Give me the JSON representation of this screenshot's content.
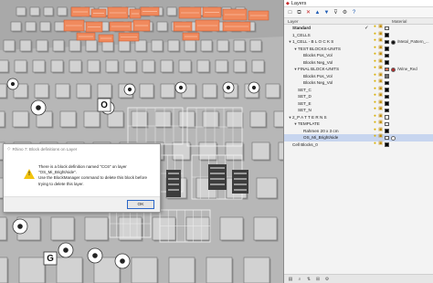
{
  "panel": {
    "title": "Layers",
    "toolbar_icons": [
      "new-layer-icon",
      "new-sublayer-icon",
      "delete-icon",
      "move-up-icon",
      "move-down-icon",
      "filter-icon",
      "tools-icon",
      "help-icon"
    ],
    "columns": {
      "layer": "Layer",
      "material": "Material"
    },
    "layers": [
      {
        "name": "Standard",
        "indent": 0,
        "bold": true,
        "expander": "",
        "current": true,
        "color": "#ffffff",
        "material": "",
        "selected": false
      },
      {
        "name": "1_CELLS",
        "indent": 0,
        "bold": false,
        "expander": "",
        "current": false,
        "color": "#000000",
        "material": "",
        "selected": false
      },
      {
        "name": "1_CELL - B L O C K S",
        "indent": 0,
        "bold": false,
        "expander": "▼",
        "current": false,
        "color": "#000000",
        "material": "/Metal_Pattern_...",
        "material_color": "#111111",
        "selected": false
      },
      {
        "name": "TEST BLOCKS-UNITS",
        "indent": 1,
        "bold": false,
        "expander": "▼",
        "current": false,
        "color": "#000000",
        "material": "",
        "selected": false
      },
      {
        "name": "Blocks Pos_Vol",
        "indent": 2,
        "bold": false,
        "expander": "",
        "current": false,
        "color": "#000000",
        "material": "",
        "selected": false
      },
      {
        "name": "Blocks Neg_Vol",
        "indent": 2,
        "bold": false,
        "expander": "",
        "current": false,
        "color": "#000000",
        "material": "",
        "selected": false
      },
      {
        "name": "FINAL BLOCK-UNITS",
        "indent": 1,
        "bold": false,
        "expander": "▼",
        "current": false,
        "color": "#d86a4a",
        "material": "/Wine_Red",
        "material_color": "#b22a2a",
        "selected": false
      },
      {
        "name": "Blocks Pos_Vol",
        "indent": 2,
        "bold": false,
        "expander": "",
        "current": false,
        "color": "#6a6a6a",
        "material": "",
        "selected": false
      },
      {
        "name": "Blocks Neg_Vol",
        "indent": 2,
        "bold": false,
        "expander": "",
        "current": false,
        "color": "#000000",
        "material": "",
        "selected": false
      },
      {
        "name": "SET_C",
        "indent": 1,
        "bold": false,
        "expander": "",
        "current": false,
        "color": "#000000",
        "material": "",
        "selected": false
      },
      {
        "name": "SET_D",
        "indent": 1,
        "bold": false,
        "expander": "",
        "current": false,
        "color": "#000000",
        "material": "",
        "selected": false
      },
      {
        "name": "SET_E",
        "indent": 1,
        "bold": false,
        "expander": "",
        "current": false,
        "color": "#000000",
        "material": "",
        "selected": false
      },
      {
        "name": "SET_N",
        "indent": 1,
        "bold": false,
        "expander": "",
        "current": false,
        "color": "#000000",
        "material": "",
        "selected": false
      },
      {
        "name": "2_P A T T E R N S",
        "indent": 0,
        "bold": false,
        "expander": "▼",
        "current": false,
        "color": "#ffffff",
        "material": "",
        "selected": false
      },
      {
        "name": "TEMPLATE",
        "indent": 1,
        "bold": false,
        "expander": "▼",
        "current": false,
        "color": "#ffffff",
        "material": "",
        "selected": false
      },
      {
        "name": "Rahmen 20 x 3 cm",
        "indent": 2,
        "bold": false,
        "expander": "",
        "current": false,
        "color": "#000000",
        "material": "",
        "selected": false
      },
      {
        "name": "OS_Mi_Bright/side",
        "indent": 2,
        "bold": false,
        "expander": "",
        "current": false,
        "color": "#ffffff",
        "material": "",
        "material_color": "#ffffff",
        "selected": true
      },
      {
        "name": "Cell Blocks_0",
        "indent": 0,
        "bold": false,
        "expander": "",
        "current": false,
        "color": "#000000",
        "material": "",
        "selected": false
      }
    ],
    "bottom_icons": [
      "layer-filter-icon",
      "search-icon",
      "sort-icon",
      "expand-icon",
      "settings-icon"
    ]
  },
  "dialog": {
    "title": "Rhino 7: Block definitions on Layer",
    "lines": [
      "There is a block definition named \"CC6\" on layer",
      "\"OS_Mi_Bright/side\".",
      "Use the BlockManager command to delete this block before",
      "trying to delete this layer."
    ],
    "ok_label": "OK"
  },
  "viewport": {
    "label_letters": [
      "O",
      "G"
    ]
  }
}
